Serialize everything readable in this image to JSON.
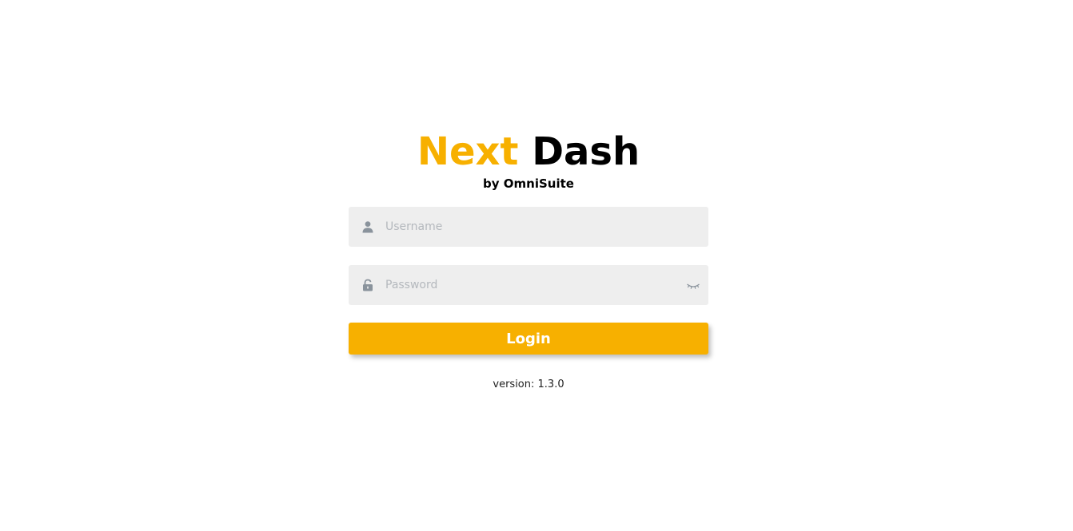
{
  "brand": {
    "title_accent": "Next",
    "title_main": "Dash",
    "subtitle": "by OmniSuite",
    "accent_color": "#f7b000"
  },
  "login_form": {
    "username": {
      "value": "",
      "placeholder": "Username",
      "icon": "user-icon"
    },
    "password": {
      "value": "",
      "placeholder": "Password",
      "icon": "lock-icon",
      "toggle_icon": "eye-closed-icon"
    },
    "submit_label": "Login"
  },
  "footer": {
    "version_text": "version: 1.3.0"
  }
}
